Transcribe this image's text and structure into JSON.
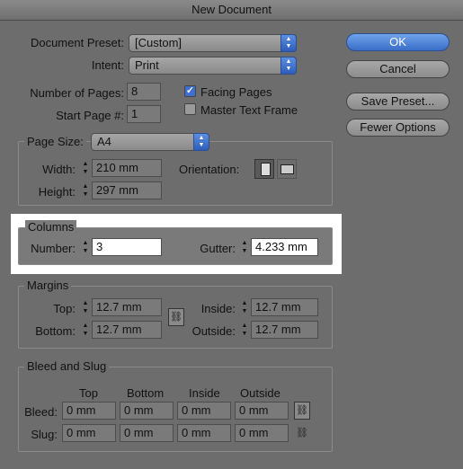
{
  "title": "New Document",
  "buttons": {
    "ok": "OK",
    "cancel": "Cancel",
    "save_preset": "Save Preset...",
    "fewer_options": "Fewer Options"
  },
  "document_preset": {
    "label": "Document Preset:",
    "value": "[Custom]"
  },
  "intent": {
    "label": "Intent:",
    "value": "Print"
  },
  "pages": {
    "number_label": "Number of Pages:",
    "number_value": "8",
    "start_label": "Start Page #:",
    "start_value": "1",
    "facing_label": "Facing Pages",
    "facing_checked": true,
    "master_label": "Master Text Frame",
    "master_checked": false
  },
  "page_size": {
    "label": "Page Size:",
    "value": "A4",
    "width_label": "Width:",
    "width_value": "210 mm",
    "height_label": "Height:",
    "height_value": "297 mm",
    "orientation_label": "Orientation:"
  },
  "columns": {
    "title": "Columns",
    "number_label": "Number:",
    "number_value": "3",
    "gutter_label": "Gutter:",
    "gutter_value": "4.233 mm"
  },
  "margins": {
    "title": "Margins",
    "top_label": "Top:",
    "top_value": "12.7 mm",
    "bottom_label": "Bottom:",
    "bottom_value": "12.7 mm",
    "inside_label": "Inside:",
    "inside_value": "12.7 mm",
    "outside_label": "Outside:",
    "outside_value": "12.7 mm"
  },
  "bleed_slug": {
    "title": "Bleed and Slug",
    "headers": [
      "Top",
      "Bottom",
      "Inside",
      "Outside"
    ],
    "bleed_label": "Bleed:",
    "bleed_values": [
      "0 mm",
      "0 mm",
      "0 mm",
      "0 mm"
    ],
    "slug_label": "Slug:",
    "slug_values": [
      "0 mm",
      "0 mm",
      "0 mm",
      "0 mm"
    ]
  }
}
